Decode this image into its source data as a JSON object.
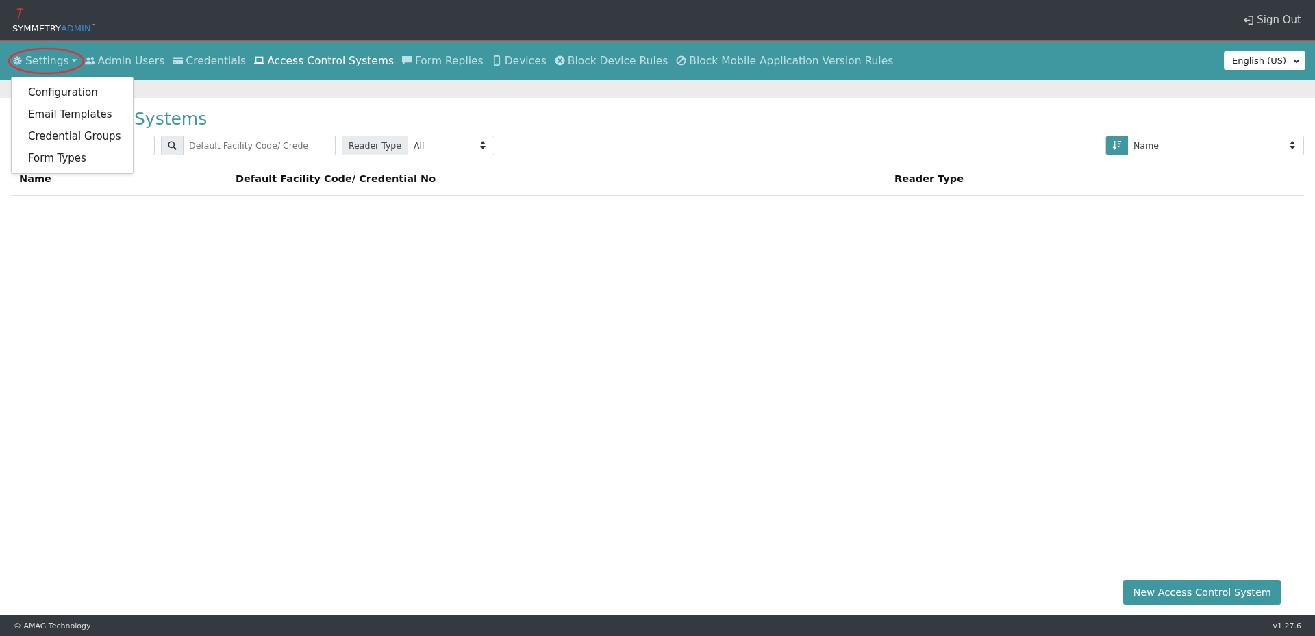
{
  "header": {
    "logo": {
      "primary": "SYMMETRY",
      "secondary": "ADMIN",
      "mark": "™"
    },
    "sign_out": "Sign Out"
  },
  "nav": {
    "items": [
      {
        "label": "Settings",
        "selected": false,
        "dropdown": true,
        "highlighted": true
      },
      {
        "label": "Admin Users",
        "selected": false,
        "dropdown": false,
        "highlighted": false
      },
      {
        "label": "Credentials",
        "selected": false,
        "dropdown": false,
        "highlighted": false
      },
      {
        "label": "Access Control Systems",
        "selected": true,
        "dropdown": false,
        "highlighted": false
      },
      {
        "label": "Form Replies",
        "selected": false,
        "dropdown": false,
        "highlighted": false
      },
      {
        "label": "Devices",
        "selected": false,
        "dropdown": false,
        "highlighted": false
      },
      {
        "label": "Block Device Rules",
        "selected": false,
        "dropdown": false,
        "highlighted": false
      },
      {
        "label": "Block Mobile Application Version Rules",
        "selected": false,
        "dropdown": false,
        "highlighted": false
      }
    ],
    "language": "English (US)"
  },
  "settings_menu": {
    "expanded": true,
    "items": [
      "Configuration",
      "Email Templates",
      "Credential Groups",
      "Form Types"
    ]
  },
  "page": {
    "title": "Systems",
    "filters": {
      "facility_placeholder": "Default Facility Code/ Crede",
      "reader_type_label": "Reader Type",
      "reader_type_value": "All",
      "sort_value": "Name"
    },
    "table": {
      "columns": [
        "Name",
        "Default Facility Code/ Credential No",
        "Reader Type"
      ]
    },
    "new_button": "New Access Control System"
  },
  "footer": {
    "copyright": "© AMAG Technology",
    "version": "v1.27.6"
  }
}
